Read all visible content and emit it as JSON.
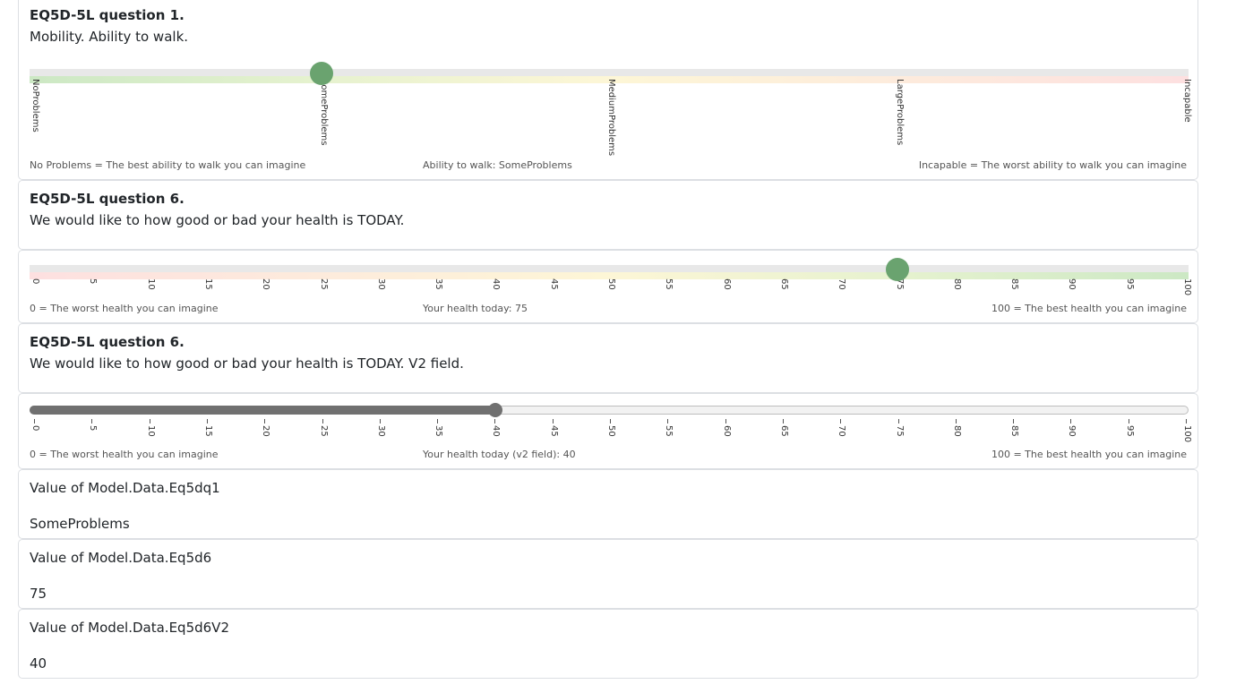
{
  "q1": {
    "title": "EQ5D-5L question 1.",
    "text": "Mobility. Ability to walk.",
    "ticks": [
      "NoProblems",
      "SomeProblems",
      "MediumProblems",
      "LargeProblems",
      "Incapable"
    ],
    "selected_index": 1,
    "left_label": "No Problems = The best ability to walk you can imagine",
    "center_label": "Ability to walk: SomeProblems",
    "right_label": "Incapable = The worst ability to walk you can imagine"
  },
  "q6": {
    "title": "EQ5D-5L question 6.",
    "text": "We would like to how good or bad your health is TODAY.",
    "ticks": [
      "0",
      "5",
      "10",
      "15",
      "20",
      "25",
      "30",
      "35",
      "40",
      "45",
      "50",
      "55",
      "60",
      "65",
      "70",
      "75",
      "80",
      "85",
      "90",
      "95",
      "100"
    ],
    "value": 75,
    "left_label": "0 = The worst health you can imagine",
    "center_label": "Your health today: 75",
    "right_label": "100 = The best health you can imagine"
  },
  "q6v2": {
    "title": "EQ5D-5L question 6.",
    "text": "We would like to how good or bad your health is TODAY. V2 field.",
    "ticks": [
      "0",
      "5",
      "10",
      "15",
      "20",
      "25",
      "30",
      "35",
      "40",
      "45",
      "50",
      "55",
      "60",
      "65",
      "70",
      "75",
      "80",
      "85",
      "90",
      "95",
      "100"
    ],
    "value": 40,
    "left_label": "0 = The worst health you can imagine",
    "center_label": "Your health today (v2 field): 40",
    "right_label": "100 = The best health you can imagine"
  },
  "values": [
    {
      "label": "Value of Model.Data.Eq5dq1",
      "value": "SomeProblems"
    },
    {
      "label": "Value of Model.Data.Eq5d6",
      "value": "75"
    },
    {
      "label": "Value of Model.Data.Eq5d6V2",
      "value": "40"
    }
  ],
  "colors": {
    "knob": "#6aa36f",
    "track_bg": "#e8e8e8",
    "green": "#cce8c4",
    "yellow": "#fdf6d6",
    "red": "#fde0e0"
  }
}
